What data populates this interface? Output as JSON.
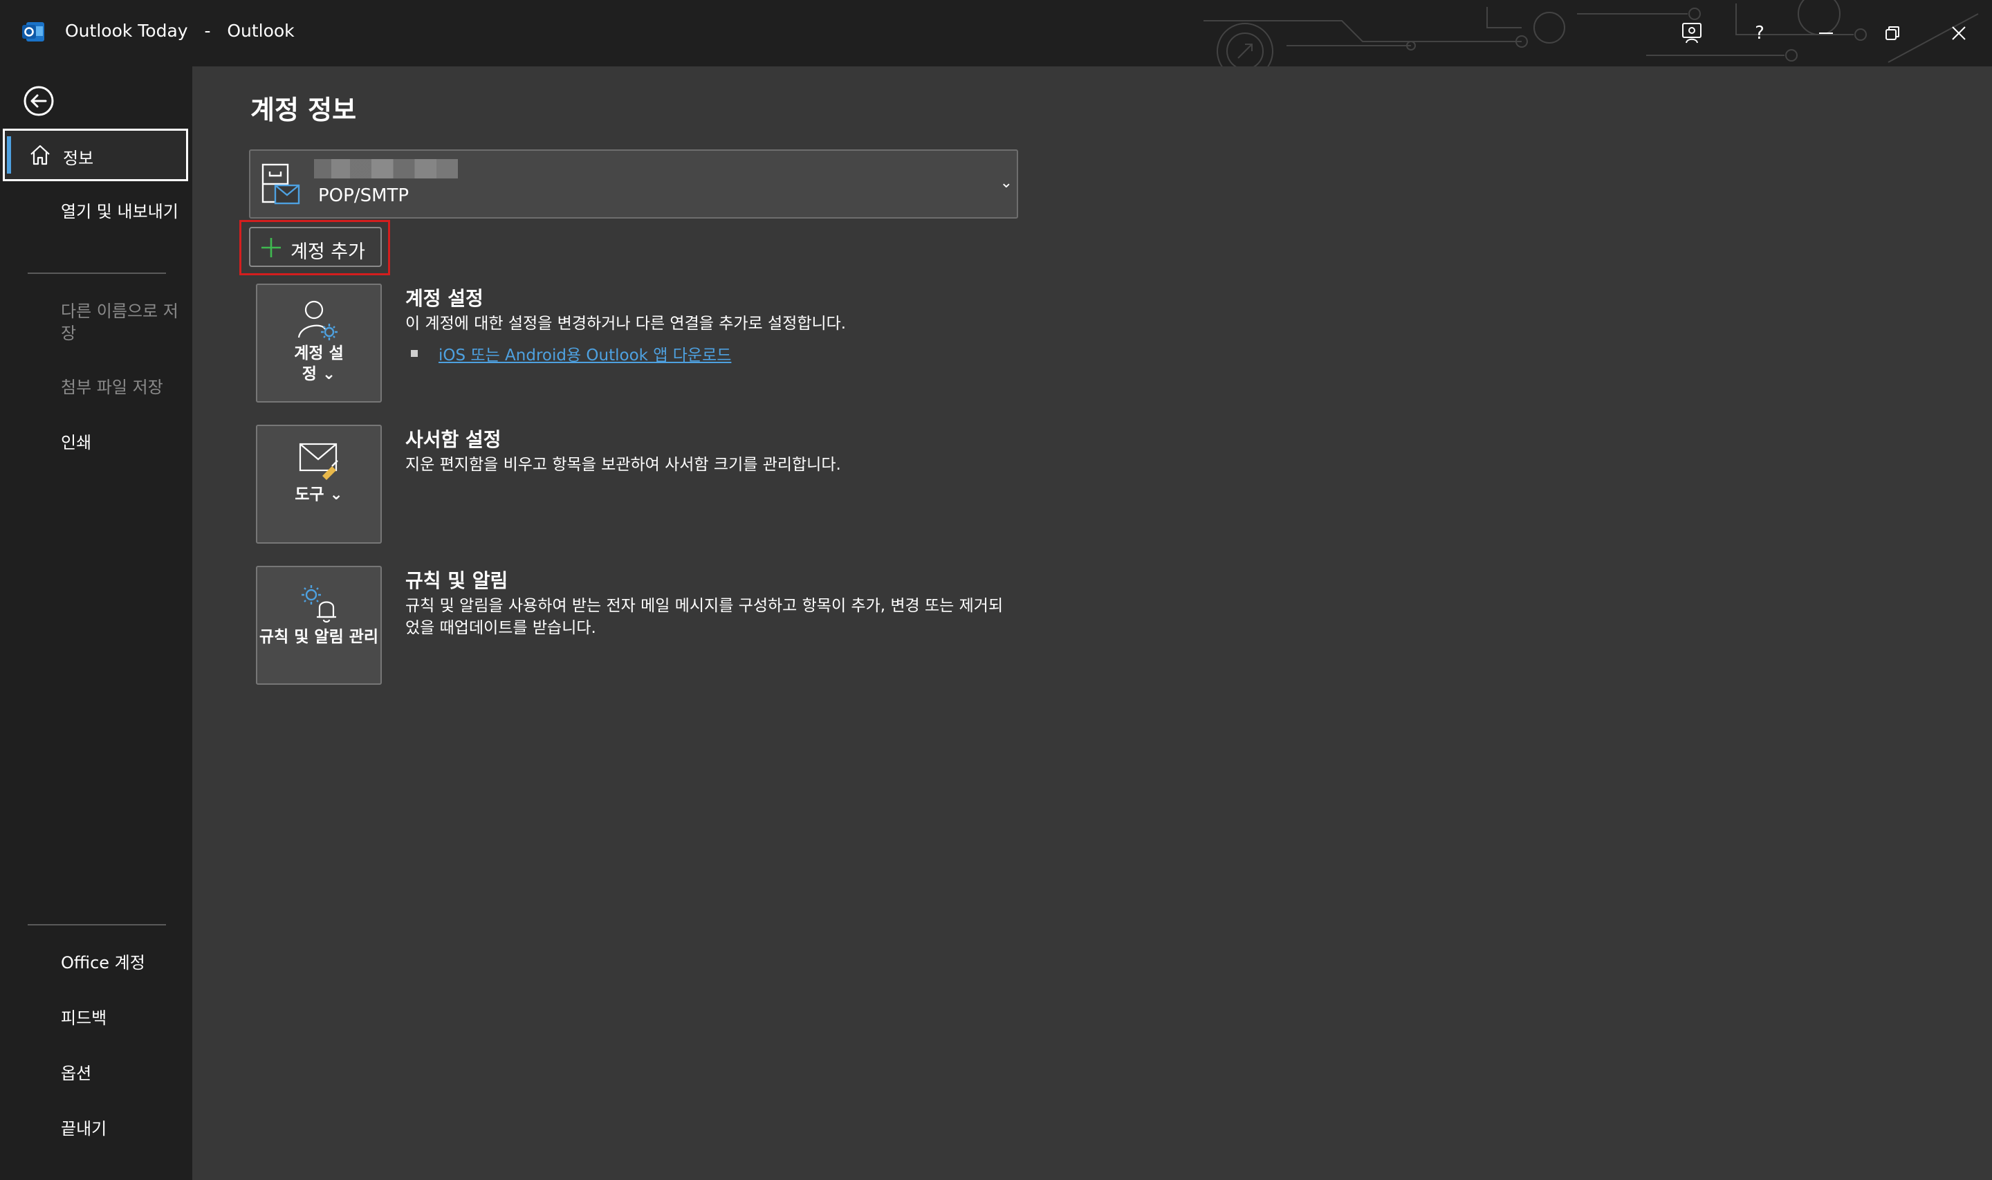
{
  "window": {
    "title": "Outlook Today",
    "separator": "-",
    "app_name": "Outlook"
  },
  "titlebar_buttons": {
    "help": "?"
  },
  "sidebar": {
    "selected": "정보",
    "items": [
      {
        "label": "열기 및 내보내기",
        "enabled": true
      },
      {
        "label": "다른 이름으로 저장",
        "enabled": false
      },
      {
        "label": "첨부 파일 저장",
        "enabled": false
      },
      {
        "label": "인쇄",
        "enabled": true
      }
    ],
    "bottom_items": [
      {
        "label": "Office 계정"
      },
      {
        "label": "피드백"
      },
      {
        "label": "옵션"
      },
      {
        "label": "끝내기"
      }
    ]
  },
  "main": {
    "title": "계정 정보",
    "account": {
      "type": "POP/SMTP",
      "chevron": "⌄"
    },
    "add_account_label": "계정 추가",
    "sections": [
      {
        "tile_label": "계정 설정 ⌄",
        "title": "계정 설정",
        "description": "이 계정에 대한 설정을 변경하거나 다른 연결을 추가로 설정합니다.",
        "link": "iOS 또는 Android용 Outlook 앱 다운로드"
      },
      {
        "tile_label": "도구 ⌄",
        "title": "사서함 설정",
        "description": "지운 편지함을 비우고 항목을 보관하여 사서함 크기를 관리합니다."
      },
      {
        "tile_label": "규칙 및 알림 관리",
        "title": "규칙 및 알림",
        "description": "규칙 및 알림을 사용하여 받는 전자 메일 메시지를 구성하고 항목이 추가, 변경 또는 제거되었을 때업데이트를 받습니다."
      }
    ]
  },
  "colors": {
    "accent": "#4ea1e0",
    "main_bg": "#383838",
    "sidebar_bg": "#1f1f1f",
    "highlight_border": "#d41e1e",
    "plus_icon": "#3fb950"
  }
}
